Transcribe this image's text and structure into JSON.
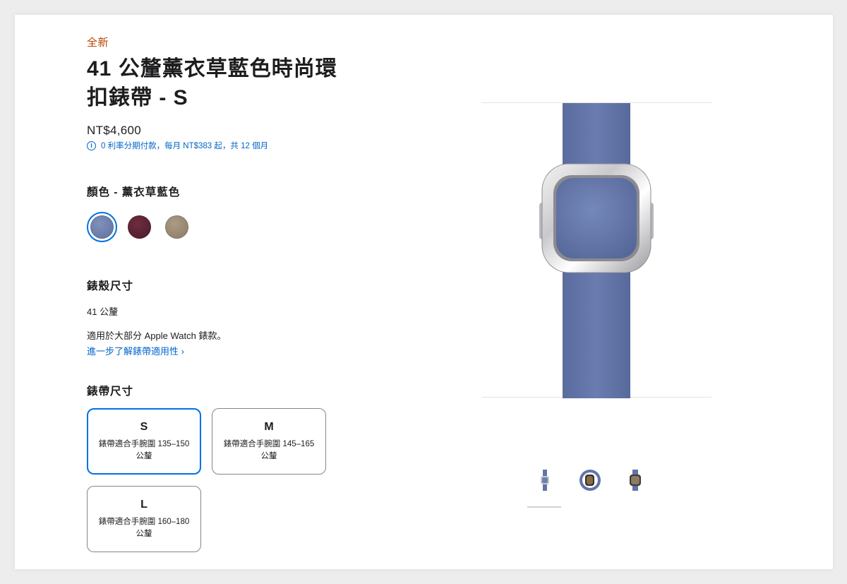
{
  "product": {
    "eyebrow": "全新",
    "title": "41 公釐薰衣草藍色時尚環扣錶帶 - S",
    "price": "NT$4,600",
    "installment": "0 利率分期付款，每月 NT$383 起，共 12 個月"
  },
  "color": {
    "label": "顏色 - 薰衣草藍色",
    "selected_index": 0,
    "swatches": [
      {
        "name": "薰衣草藍色",
        "hex": "#6b7fa8"
      },
      {
        "name": "dark-cherry",
        "hex": "#5a2332"
      },
      {
        "name": "chalky",
        "hex": "#9b8a73"
      }
    ]
  },
  "case_size": {
    "label": "錶殼尺寸",
    "value": "41 公釐",
    "compat_text": "適用於大部分 Apple Watch 錶款。",
    "compat_link": "進一步了解錶帶適用性 ›"
  },
  "band_size": {
    "label": "錶帶尺寸",
    "options": [
      {
        "size": "S",
        "desc": "錶帶適合手腕圍 135–150 公釐",
        "selected": true
      },
      {
        "size": "M",
        "desc": "錶帶適合手腕圍 145–165 公釐",
        "selected": false
      },
      {
        "size": "L",
        "desc": "錶帶適合手腕圍 160–180 公釐",
        "selected": false
      }
    ]
  },
  "gallery": {
    "thumbnails": [
      "band-front-view",
      "watch-side-view",
      "watch-front-view"
    ],
    "active_index": 0
  },
  "colors": {
    "accent": "#0071e3",
    "link": "#0066cc",
    "eyebrow": "#b64400",
    "band": "#6274a7"
  }
}
